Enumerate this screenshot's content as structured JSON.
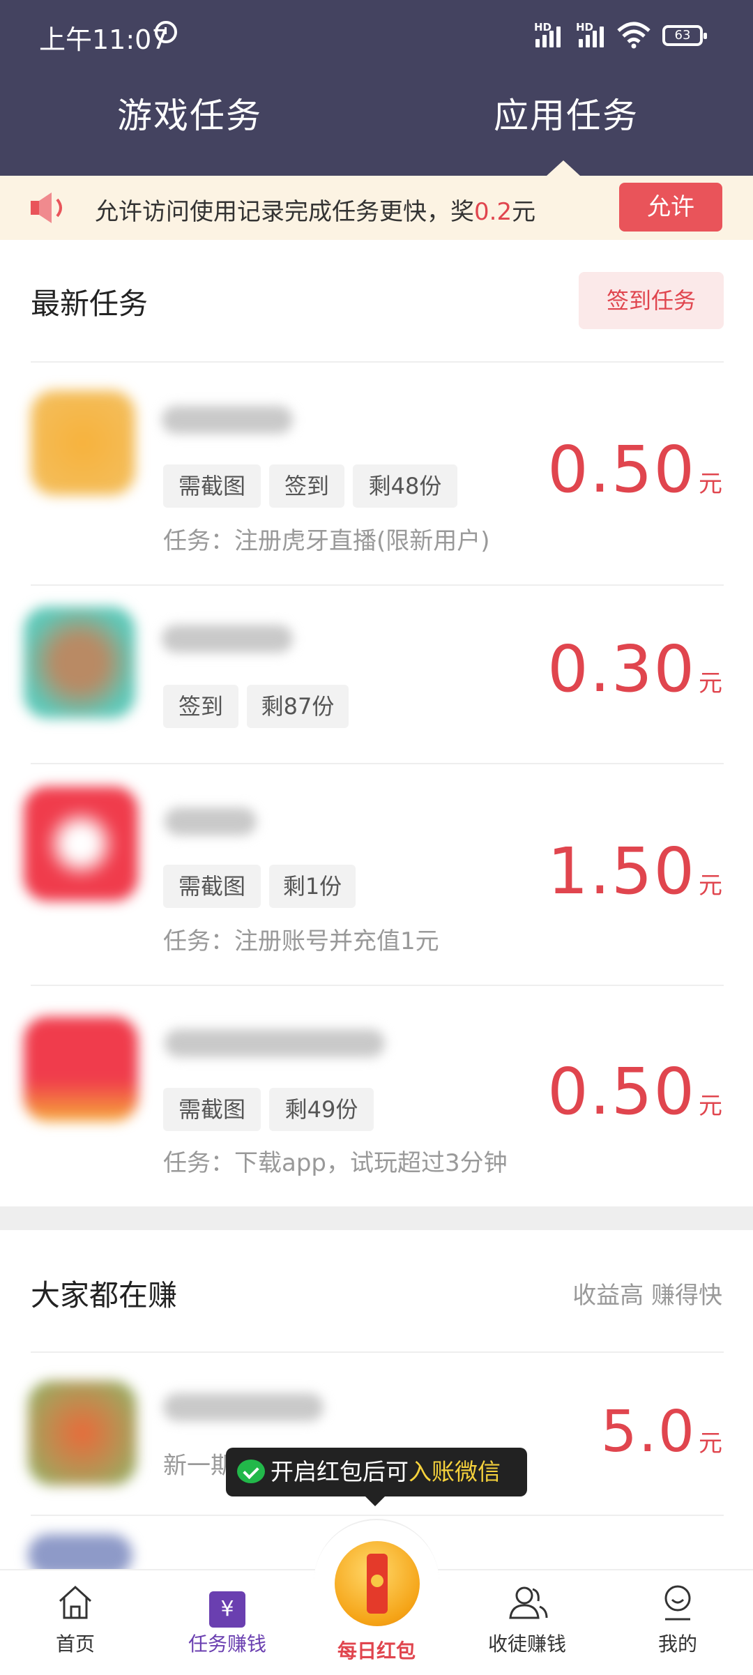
{
  "status_bar": {
    "time": "上午11:07",
    "hd1": "HD",
    "hd2": "HD",
    "battery": "63"
  },
  "tabs": {
    "game": "游戏任务",
    "app": "应用任务"
  },
  "notice": {
    "text_prefix": "允许访问使用记录完成任务更快，奖",
    "amount": "0.2",
    "text_suffix": "元",
    "button": "允许"
  },
  "latest": {
    "title": "最新任务",
    "checkin_button": "签到任务",
    "tasks": [
      {
        "tags": [
          "需截图",
          "签到",
          "剩48份"
        ],
        "desc": "任务：注册虎牙直播(限新用户)",
        "price": "0.50",
        "unit": "元"
      },
      {
        "tags": [
          "签到",
          "剩87份"
        ],
        "desc": "",
        "price": "0.30",
        "unit": "元"
      },
      {
        "tags": [
          "需截图",
          "剩1份"
        ],
        "desc": "任务：注册账号并充值1元",
        "price": "1.50",
        "unit": "元"
      },
      {
        "tags": [
          "需截图",
          "剩49份"
        ],
        "desc": "任务：下载app，试玩超过3分钟",
        "price": "0.50",
        "unit": "元"
      }
    ]
  },
  "popular": {
    "title": "大家都在赚",
    "subtitle": "收益高 赚得快",
    "items": [
      {
        "desc": "新一期",
        "price": "5.0",
        "unit": "元"
      }
    ]
  },
  "tooltip": {
    "prefix": "开启红包后可",
    "highlight": "入账微信"
  },
  "nav": {
    "home": "首页",
    "tasks": "任务赚钱",
    "redpack": "每日红包",
    "recruit": "收徒赚钱",
    "mine": "我的",
    "tasks_icon": "¥"
  },
  "colors": {
    "header": "#444360",
    "accent": "#e0454e",
    "notice_bg": "#fcf3e3",
    "nav_active": "#6a3fb0"
  }
}
